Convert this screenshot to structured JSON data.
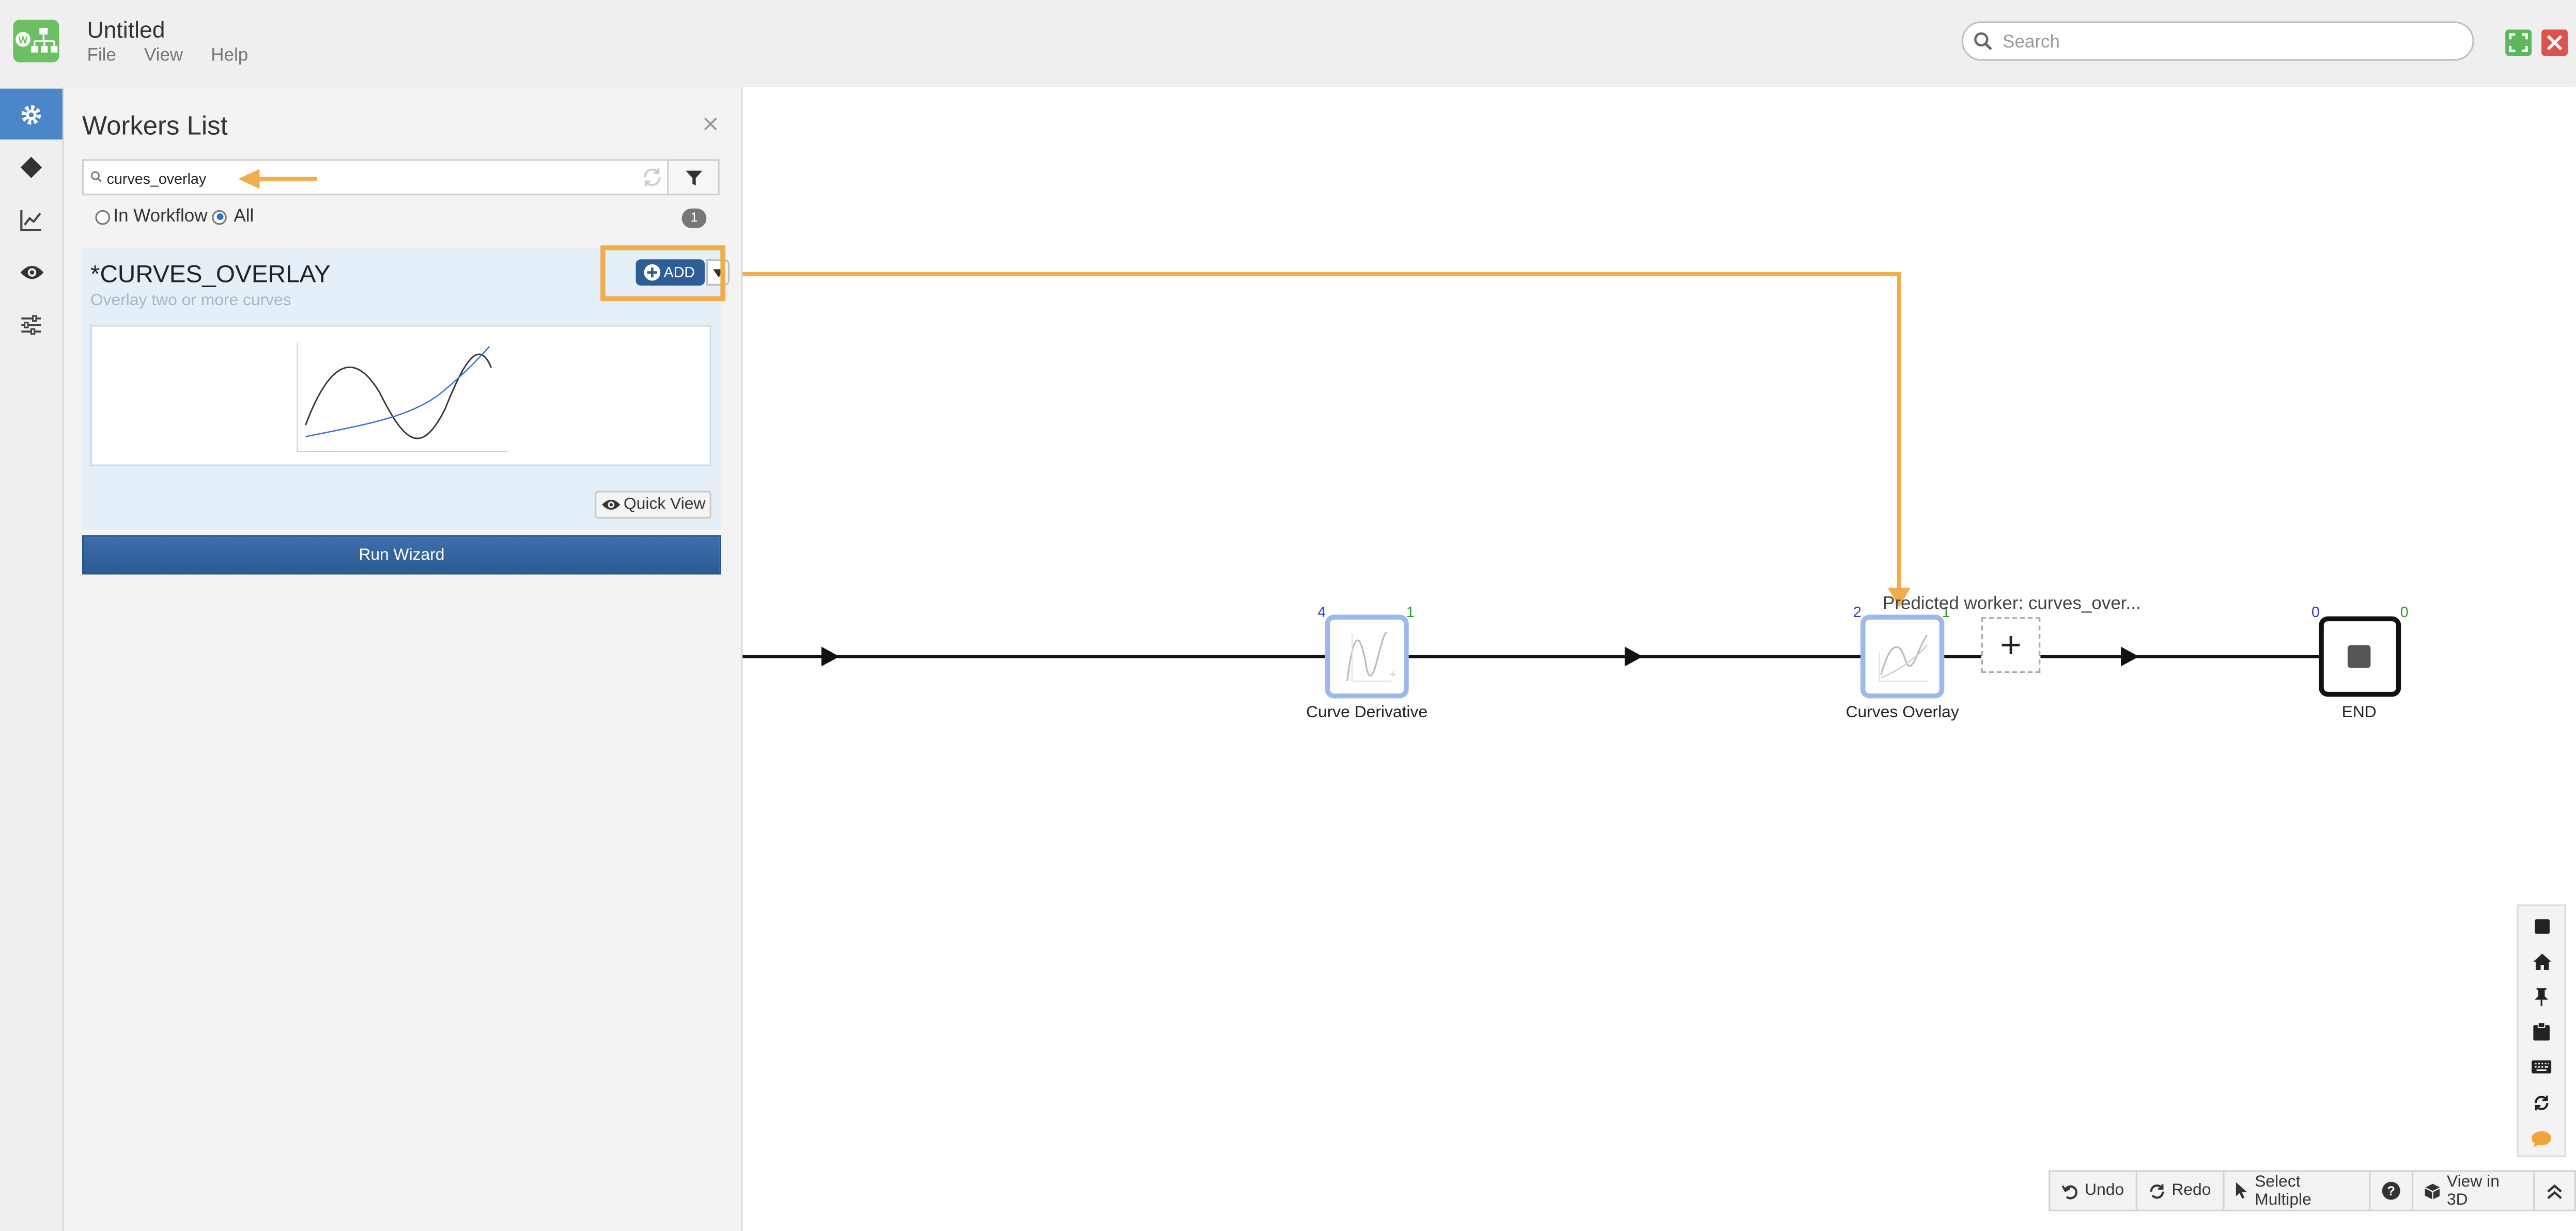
{
  "app": {
    "title": "Untitled",
    "menu": [
      "File",
      "View",
      "Help"
    ],
    "search_placeholder": "Search"
  },
  "colors": {
    "accent": "#4a86c8",
    "highlight": "#f0ad4e",
    "add_button": "#2f5d96",
    "fullscreen": "#5cb85c",
    "close": "#d9534f"
  },
  "sidebar": {
    "icons": [
      "gear-icon",
      "diamond-icon",
      "chart-icon",
      "eye-icon",
      "sliders-icon"
    ],
    "active": "gear-icon"
  },
  "workers_panel": {
    "title": "Workers List",
    "search_value": "curves_overlay",
    "filters": [
      {
        "label": "In Workflow",
        "checked": false
      },
      {
        "label": "All",
        "checked": true
      }
    ],
    "count": "1",
    "worker": {
      "name": "CURVES_OVERLAY",
      "description": "Overlay two or more curves",
      "add_label": "ADD",
      "quick_view_label": "Quick View"
    },
    "run_wizard_label": "Run Wizard"
  },
  "workflow": {
    "nodes": [
      {
        "label": "Curve Derivative",
        "in": "4",
        "out": "1"
      },
      {
        "label": "Curves Overlay",
        "in": "2",
        "out": "1"
      },
      {
        "label": "END",
        "in": "0",
        "out": "0"
      }
    ],
    "predicted_worker": "Predicted worker: curves_over..."
  },
  "toolbar": {
    "undo": "Undo",
    "redo": "Redo",
    "select_multiple": "Select Multiple",
    "help": "?",
    "view_3d": "View in 3D"
  },
  "right_tools": [
    "stop-icon",
    "home-icon",
    "pin-icon",
    "clipboard-icon",
    "keyboard-icon",
    "refresh-icon",
    "chat-icon"
  ]
}
